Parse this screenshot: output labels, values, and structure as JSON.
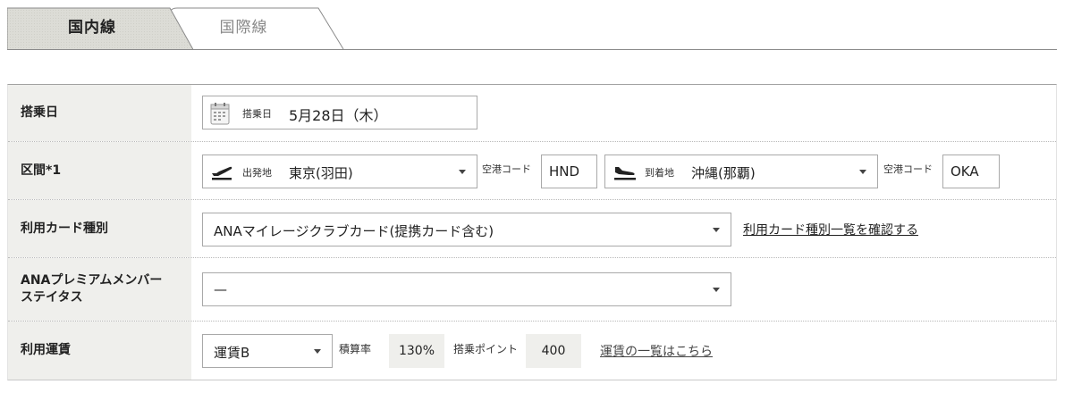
{
  "tabs": {
    "domestic": "国内線",
    "international": "国際線"
  },
  "form": {
    "boarding_date": {
      "label": "搭乗日",
      "inner_label": "搭乗日",
      "value": "5月28日（木）",
      "icon": "calendar-icon"
    },
    "route": {
      "label": "区間*1",
      "departure": {
        "icon": "airplane-takeoff-icon",
        "inner_label": "出発地",
        "value": "東京(羽田)",
        "code_label": "空港コード",
        "code": "HND"
      },
      "arrival": {
        "icon": "airplane-landing-icon",
        "inner_label": "到着地",
        "value": "沖縄(那覇)",
        "code_label": "空港コード",
        "code": "OKA"
      }
    },
    "card_type": {
      "label": "利用カード種別",
      "value": "ANAマイレージクラブカード(提携カード含む)",
      "link": "利用カード種別一覧を確認する"
    },
    "premium_status": {
      "label_line1": "ANAプレミアムメンバー",
      "label_line2": "ステイタス",
      "value": "—"
    },
    "fare": {
      "label": "利用運賃",
      "value": "運賃B",
      "rate_label": "積算率",
      "rate": "130%",
      "points_label": "搭乗ポイント",
      "points": "400",
      "link": "運賃の一覧はこちら"
    }
  }
}
